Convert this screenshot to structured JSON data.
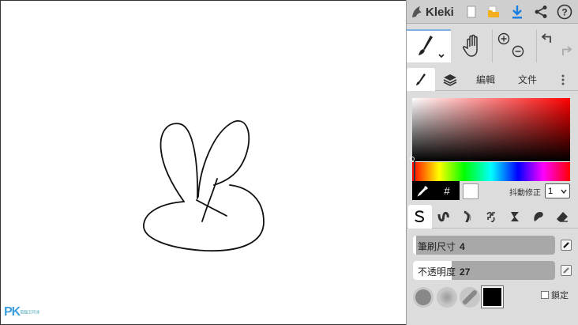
{
  "app": {
    "name": "Kleki"
  },
  "tabs": {
    "edit": "編輯",
    "file": "文件"
  },
  "picker": {
    "hex_symbol": "#",
    "stabilizer_label": "抖動修正",
    "stabilizer_value": "1"
  },
  "brush": {
    "size_label": "筆刷尺寸",
    "size_value": "4",
    "size_fraction": 0.02,
    "opacity_label": "不透明度",
    "opacity_value": "27",
    "opacity_fraction": 0.27,
    "lock_label": "鎖定"
  },
  "colors": {
    "primary": "#000000",
    "secondary": "#ffffff",
    "accent": "#1a7fe0"
  },
  "icons": {
    "topbar": [
      "kleki-logo-icon",
      "new-file-icon",
      "open-folder-icon",
      "download-icon",
      "share-icon",
      "help-icon"
    ],
    "tools": [
      "brush-icon",
      "hand-icon",
      "zoom-in-icon",
      "zoom-out-icon",
      "undo-icon",
      "redo-icon"
    ],
    "brush_types": [
      "pen-brush-icon",
      "blend-brush-icon",
      "sketchy-brush-icon",
      "pixel-brush-icon",
      "chemy-brush-icon",
      "smudge-brush-icon",
      "eraser-icon"
    ]
  },
  "watermark": {
    "brand": "PK",
    "sub": "電腦王阿達"
  }
}
